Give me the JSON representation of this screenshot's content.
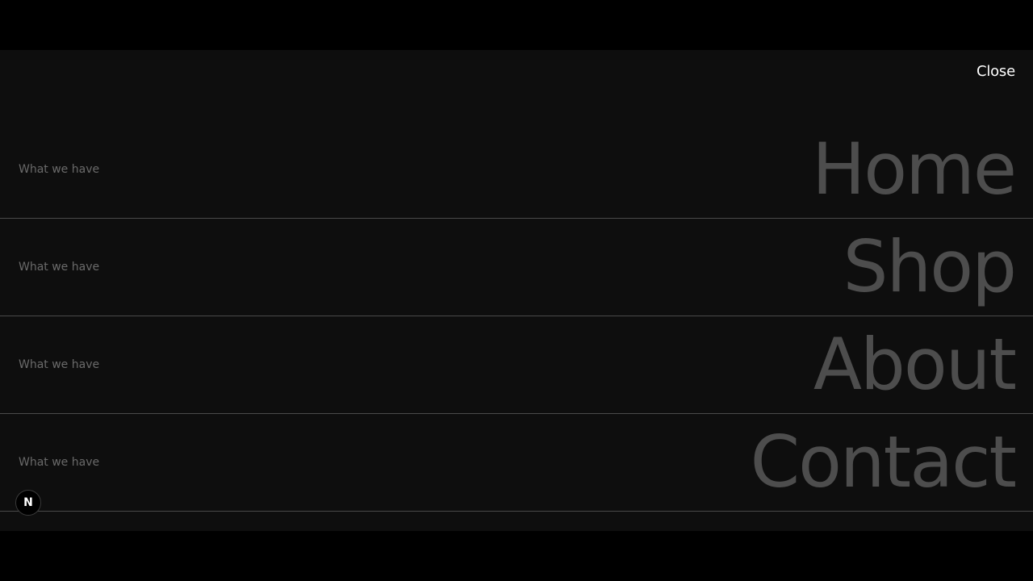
{
  "header": {
    "close_label": "Close"
  },
  "menu": {
    "items": [
      {
        "caption": "What we have",
        "label": "Home"
      },
      {
        "caption": "What we have",
        "label": "Shop"
      },
      {
        "caption": "What we have",
        "label": "About"
      },
      {
        "caption": "What we have",
        "label": "Contact"
      }
    ]
  },
  "badge": {
    "letter": "N",
    "icon": "nextjs-logo-icon"
  },
  "colors": {
    "overlay_bg": "#0e0e0e",
    "letterbox_bg": "#000000",
    "menu_text": "#4d4d4d",
    "caption_text": "#6a6a6a",
    "divider": "#4a4a4a",
    "close_text": "#ffffff"
  }
}
